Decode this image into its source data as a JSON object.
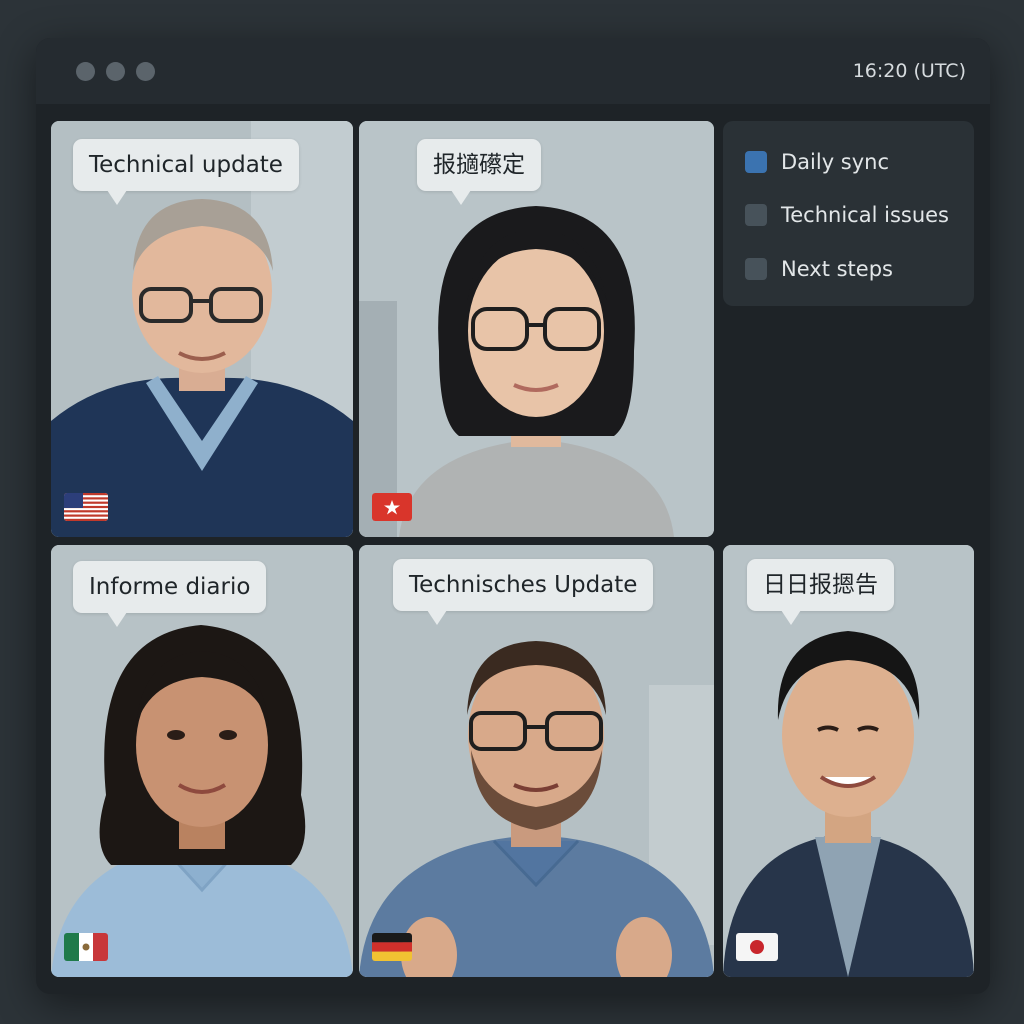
{
  "window": {
    "time": "16:20 (UTC)"
  },
  "agenda": {
    "items": [
      {
        "label": "Daily sync",
        "active": true
      },
      {
        "label": "Technical issues",
        "active": false
      },
      {
        "label": "Next steps",
        "active": false
      }
    ]
  },
  "participants": [
    {
      "caption": "Technical update",
      "flag": "us-flag-icon"
    },
    {
      "caption": "报擿礤定",
      "flag": "china-flag-icon"
    },
    {
      "caption": "Informe diario",
      "flag": "mexico-flag-icon"
    },
    {
      "caption": "Technisches Update",
      "flag": "germany-flag-icon"
    },
    {
      "caption": "日日报摁告",
      "flag": "japan-flag-icon"
    }
  ],
  "colors": {
    "accent": "#3b73b0",
    "window_bg": "#1e2327",
    "bubble_bg": "#e7ebec"
  }
}
